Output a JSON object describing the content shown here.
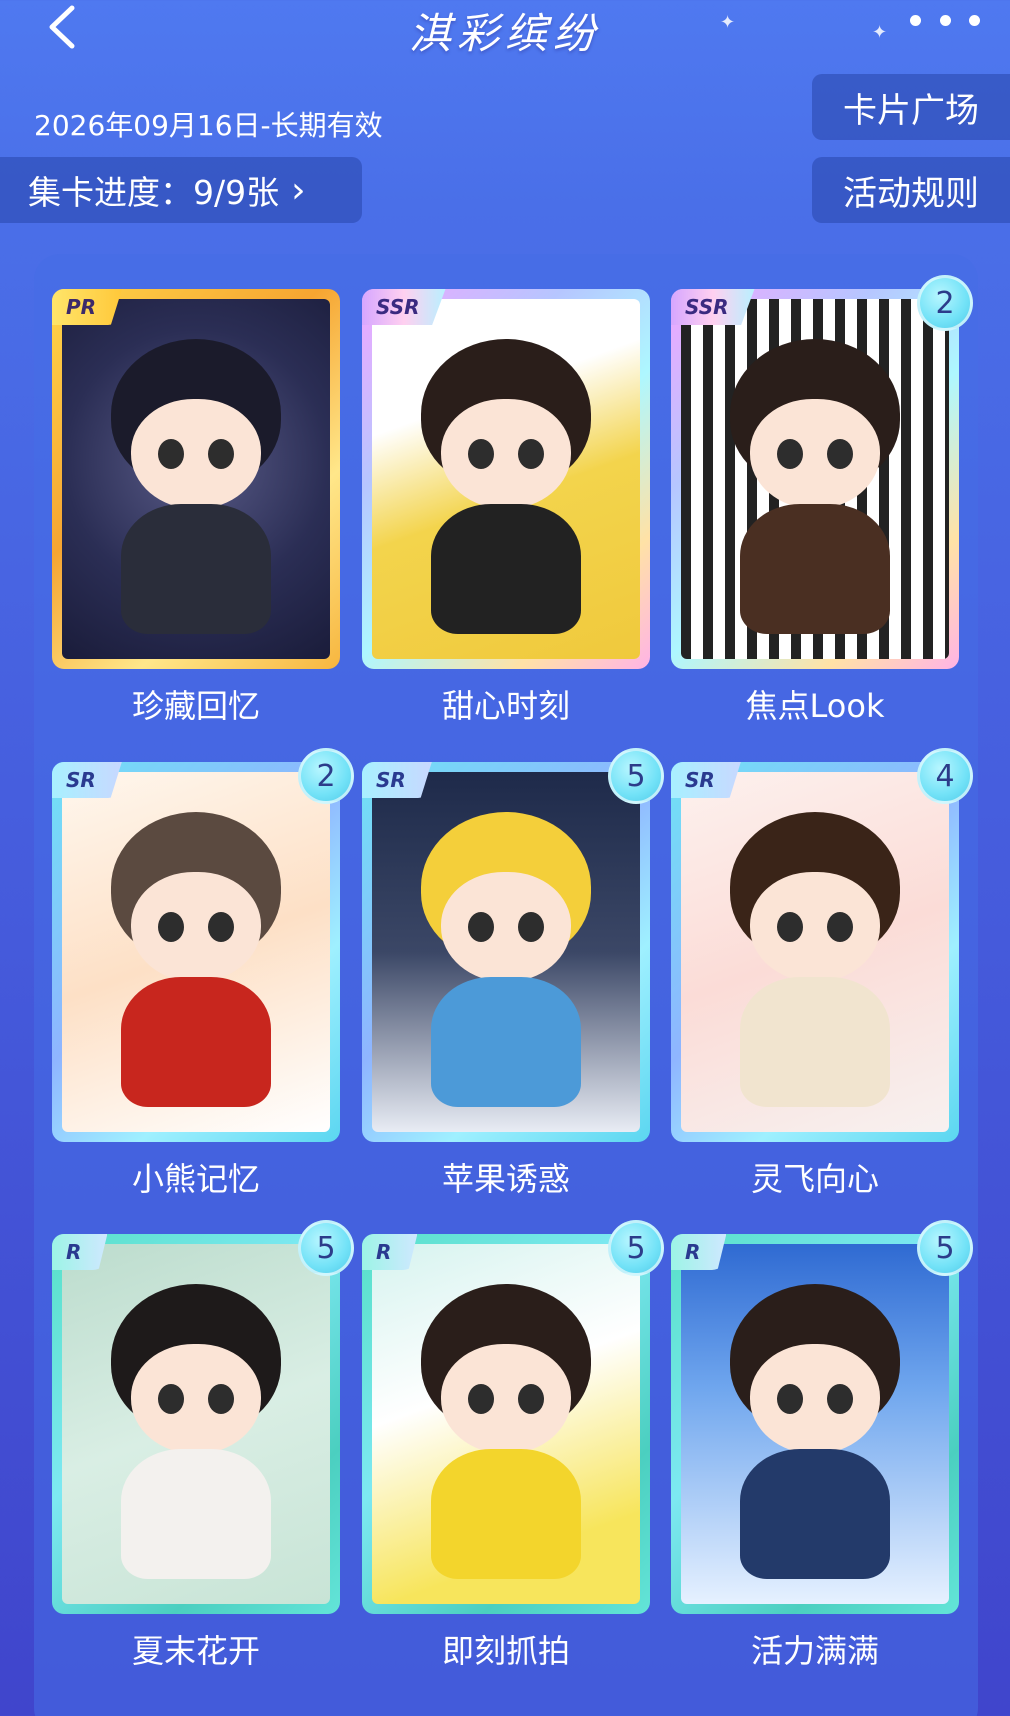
{
  "header": {
    "title": "淇彩缤纷",
    "validity": "2026年09月16日-长期有效"
  },
  "progress": {
    "label": "集卡进度：9/9张",
    "chevron": "›"
  },
  "buttons": {
    "card_square": "卡片广场",
    "rules": "活动规则"
  },
  "cards": [
    {
      "name": "珍藏回忆",
      "rarity": "PR",
      "count": ""
    },
    {
      "name": "甜心时刻",
      "rarity": "SSR",
      "count": ""
    },
    {
      "name": "焦点Look",
      "rarity": "SSR",
      "count": "2"
    },
    {
      "name": "小熊记忆",
      "rarity": "SR",
      "count": "2"
    },
    {
      "name": "苹果诱惑",
      "rarity": "SR",
      "count": "5"
    },
    {
      "name": "灵飞向心",
      "rarity": "SR",
      "count": "4"
    },
    {
      "name": "夏末花开",
      "rarity": "R",
      "count": "5"
    },
    {
      "name": "即刻抓拍",
      "rarity": "R",
      "count": "5"
    },
    {
      "name": "活力满满",
      "rarity": "R",
      "count": "5"
    }
  ]
}
